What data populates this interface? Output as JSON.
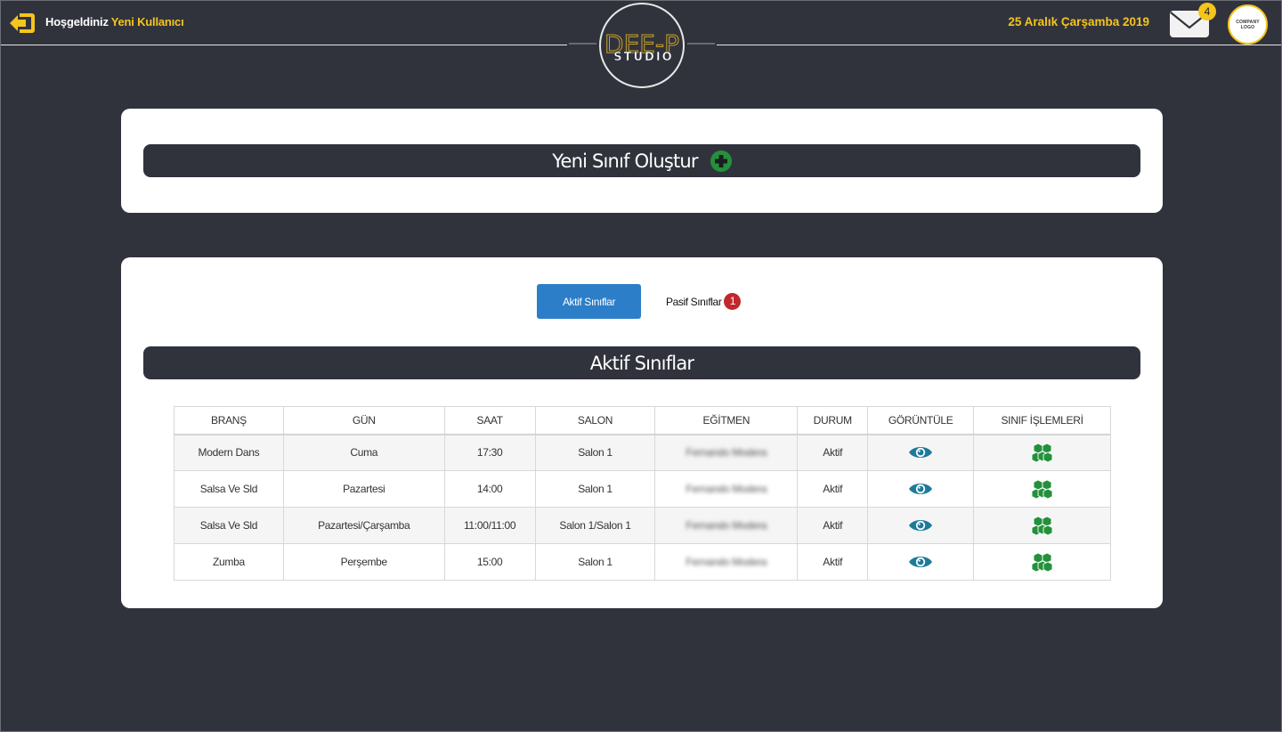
{
  "header": {
    "welcome_text": "Hoşgeldiniz",
    "user_name": "Yeni Kullanıcı",
    "brand_text_top": "DEE-P",
    "brand_text_bottom": "STUDIO",
    "date": "25 Aralık Çarşamba 2019",
    "mail_count": "4",
    "company_logo_text": "COMPANY LOGO"
  },
  "create": {
    "title": "Yeni Sınıf Oluştur"
  },
  "tabs": {
    "active_label": "Aktif Sınıflar",
    "passive_label": "Pasif Sınıflar",
    "passive_count": "1"
  },
  "list": {
    "title": "Aktif Sınıflar",
    "columns": [
      "BRANŞ",
      "GÜN",
      "SAAT",
      "SALON",
      "EĞİTMEN",
      "DURUM",
      "GÖRÜNTÜLE",
      "SINIF İŞLEMLERİ"
    ],
    "rows": [
      {
        "brans": "Modern Dans",
        "gun": "Cuma",
        "saat": "17:30",
        "salon": "Salon 1",
        "egitmen": "Fernando Modera",
        "durum": "Aktif"
      },
      {
        "brans": "Salsa Ve Sld",
        "gun": "Pazartesi",
        "saat": "14:00",
        "salon": "Salon 1",
        "egitmen": "Fernando Modera",
        "durum": "Aktif"
      },
      {
        "brans": "Salsa Ve Sld",
        "gun": "Pazartesi/Çarşamba",
        "saat": "11:00/11:00",
        "salon": "Salon 1/Salon 1",
        "egitmen": "Fernando Modera",
        "durum": "Aktif"
      },
      {
        "brans": "Zumba",
        "gun": "Perşembe",
        "saat": "15:00",
        "salon": "Salon 1",
        "egitmen": "Fernando Modera",
        "durum": "Aktif"
      }
    ]
  },
  "icons": {
    "logout": "logout-icon",
    "mail": "mail-icon",
    "add": "plus-circle-icon",
    "view": "eye-icon",
    "operations": "cubes-icon"
  },
  "colors": {
    "background": "#31333c",
    "accent_yellow": "#f4c51c",
    "primary_blue": "#2c7ec8",
    "badge_red": "#c0282d",
    "icon_teal": "#1e7a99",
    "icon_green": "#23913b"
  }
}
